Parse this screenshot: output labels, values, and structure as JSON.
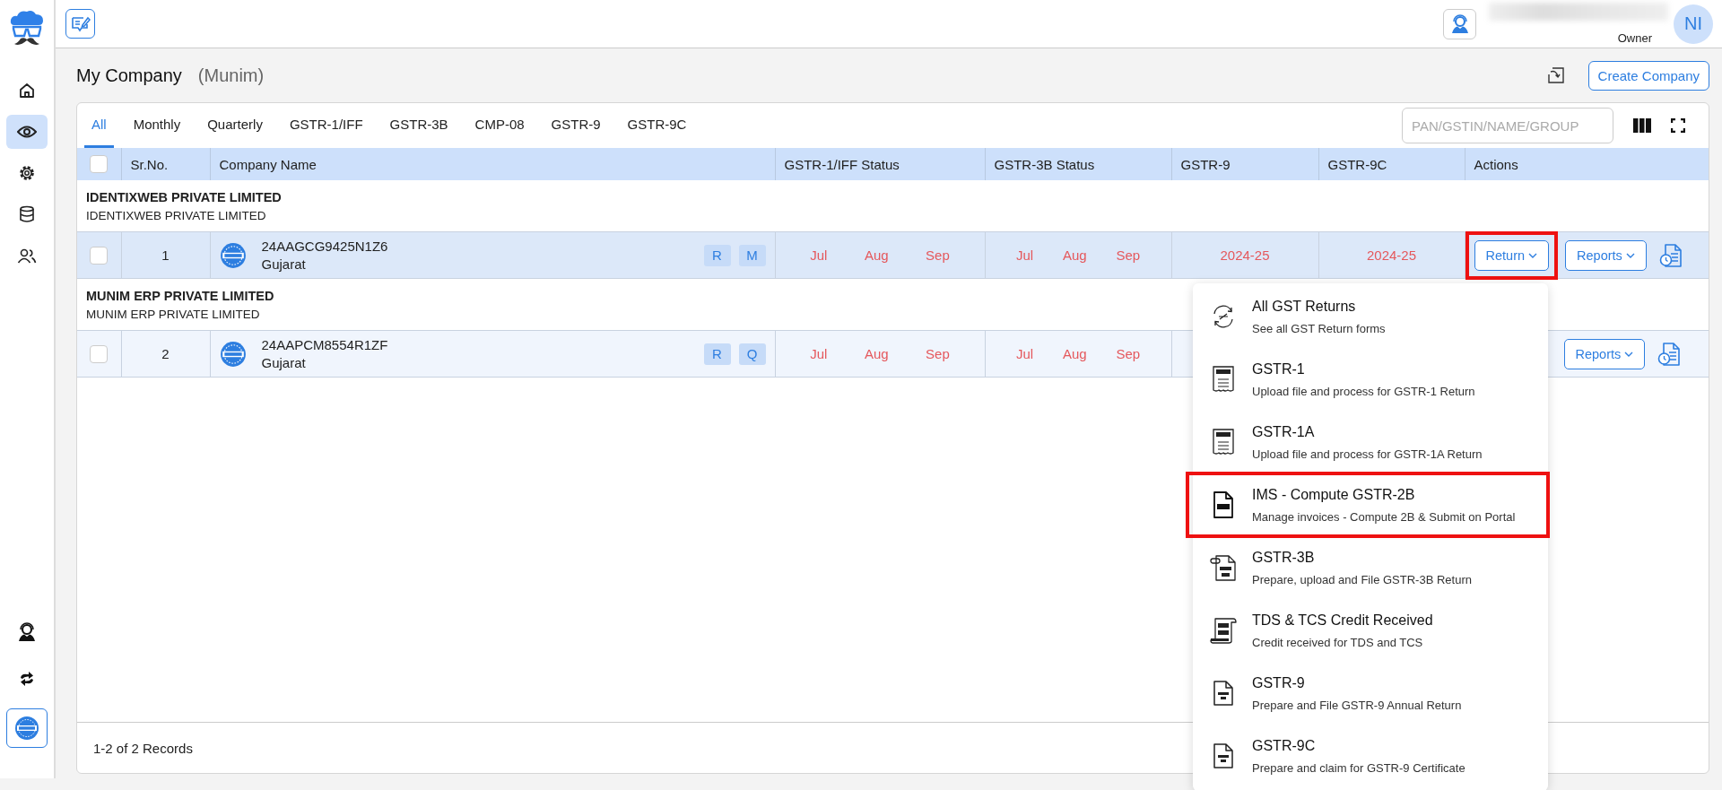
{
  "sidebar": {
    "items": [
      {
        "kind": "home",
        "selected": false
      },
      {
        "kind": "eye",
        "selected": true
      },
      {
        "kind": "gear",
        "selected": false
      },
      {
        "kind": "database",
        "selected": false
      },
      {
        "kind": "users",
        "selected": false
      }
    ],
    "bottom_items": [
      {
        "kind": "support"
      },
      {
        "kind": "sync"
      },
      {
        "kind": "gst-badge"
      }
    ]
  },
  "header": {
    "avatar_initials": "NI",
    "role": "Owner"
  },
  "page": {
    "title": "My Company",
    "subtitle": "(Munim)",
    "create_button": "Create Company"
  },
  "tabs": [
    {
      "label": "All",
      "selected": true
    },
    {
      "label": "Monthly",
      "selected": false
    },
    {
      "label": "Quarterly",
      "selected": false
    },
    {
      "label": "GSTR-1/IFF",
      "selected": false
    },
    {
      "label": "GSTR-3B",
      "selected": false
    },
    {
      "label": "CMP-08",
      "selected": false
    },
    {
      "label": "GSTR-9",
      "selected": false
    },
    {
      "label": "GSTR-9C",
      "selected": false
    }
  ],
  "search": {
    "placeholder": "PAN/GSTIN/NAME/GROUP"
  },
  "table": {
    "select_all_checked": false,
    "columns": [
      "Sr.No.",
      "Company Name",
      "GSTR-1/IFF Status",
      "GSTR-3B Status",
      "GSTR-9",
      "GSTR-9C",
      "Actions"
    ],
    "groups": [
      {
        "name": "IDENTIXWEB PRIVATE LIMITED",
        "subname": "IDENTIXWEB PRIVATE LIMITED",
        "rows": [
          {
            "sr": "1",
            "gstin": "24AAGCG9425N1Z6",
            "state": "Gujarat",
            "checked": false,
            "highlighted": true,
            "tags": [
              "R",
              "M"
            ],
            "gstr1": [
              "Jul",
              "Aug",
              "Sep"
            ],
            "gstr3b": [
              "Jul",
              "Aug",
              "Sep"
            ],
            "gstr9": "2024-25",
            "gstr9c": "2024-25",
            "return_button": {
              "label": "Return",
              "marked": true
            },
            "reports_button": "Reports"
          }
        ]
      },
      {
        "name": "MUNIM ERP PRIVATE LIMITED",
        "subname": "MUNIM ERP PRIVATE LIMITED",
        "rows": [
          {
            "sr": "2",
            "gstin": "24AAPCM8554R1ZF",
            "state": "Gujarat",
            "checked": false,
            "highlighted": false,
            "tags": [
              "R",
              "Q"
            ],
            "gstr1": [
              "Jul",
              "Aug",
              "Sep"
            ],
            "gstr3b": [
              "Jul",
              "Aug",
              "Sep"
            ],
            "reports_button": "Reports"
          }
        ]
      }
    ]
  },
  "footer": "1-2 of 2 Records",
  "menu": {
    "items": [
      {
        "kind": "gst-cycle",
        "title": "All GST Returns",
        "description": "See all GST Return forms",
        "marked": false
      },
      {
        "kind": "receipt",
        "title": "GSTR-1",
        "description": "Upload file and process for GSTR-1 Return",
        "marked": false
      },
      {
        "kind": "receipt",
        "title": "GSTR-1A",
        "description": "Upload file and process for GSTR-1A Return",
        "marked": false
      },
      {
        "kind": "doc-bold",
        "title": "IMS - Compute GSTR-2B",
        "description": "Manage invoices - Compute 2B & Submit on Portal",
        "marked": true
      },
      {
        "kind": "doc-clip",
        "title": "GSTR-3B",
        "description": "Prepare, upload and File GSTR-3B Return",
        "marked": false
      },
      {
        "kind": "scroll",
        "title": "TDS & TCS Credit Received",
        "description": "Credit received for TDS and TCS",
        "marked": false
      },
      {
        "kind": "doc",
        "title": "GSTR-9",
        "description": "Prepare and File GSTR-9 Annual Return",
        "marked": false
      },
      {
        "kind": "doc",
        "title": "GSTR-9C",
        "description": "Prepare and claim for GSTR-9 Certificate",
        "marked": false
      }
    ]
  }
}
